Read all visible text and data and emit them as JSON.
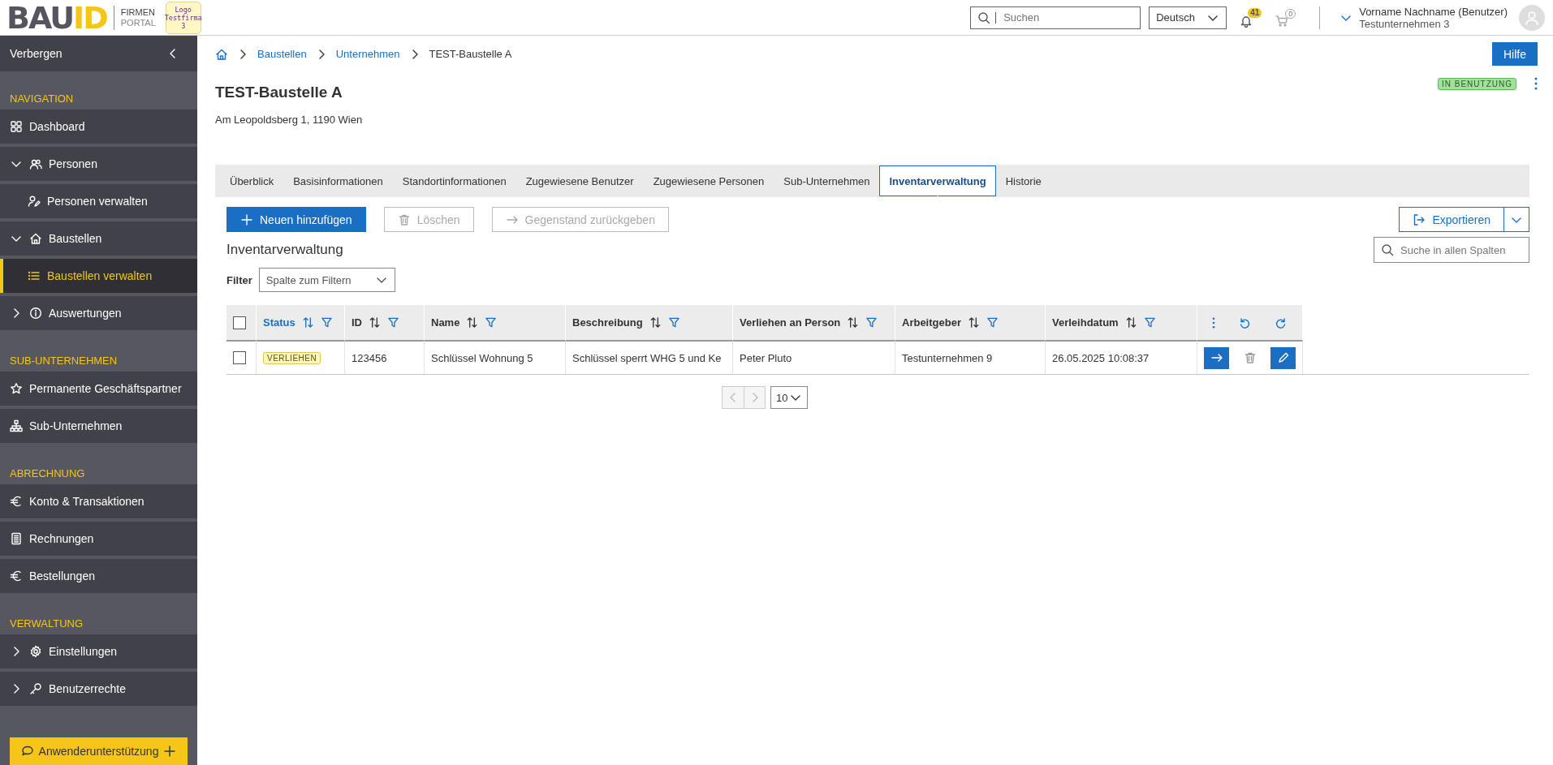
{
  "header": {
    "logo": {
      "dark": "BAU",
      "accent": "ID",
      "line_1": "FIRMEN",
      "line_2": "PORTAL"
    },
    "company_logo": [
      "Logo",
      "Testfirma",
      "3"
    ],
    "search": {
      "placeholder": "Suchen"
    },
    "language": "Deutsch",
    "notifications": "41",
    "cart": "0",
    "user": {
      "name": "Vorname Nachname (Benutzer)",
      "company": "Testunternehmen 3"
    }
  },
  "sidebar": {
    "hide_label": "Verbergen",
    "sections": [
      {
        "heading": "NAVIGATION",
        "items": [
          {
            "label": "Dashboard",
            "selected": false
          },
          {
            "label": "Personen",
            "selected": false,
            "expanded": true,
            "children": [
              {
                "label": "Personen verwalten",
                "selected": false
              }
            ]
          },
          {
            "label": "Baustellen",
            "selected": false,
            "expanded": true,
            "children": [
              {
                "label": "Baustellen verwalten",
                "selected": true
              }
            ]
          },
          {
            "label": "Auswertungen",
            "selected": false,
            "expanded": false
          }
        ]
      },
      {
        "heading": "SUB-UNTERNEHMEN",
        "items": [
          {
            "label": "Permanente Geschäftspartner",
            "selected": false
          },
          {
            "label": "Sub-Unternehmen",
            "selected": false
          }
        ]
      },
      {
        "heading": "ABRECHNUNG",
        "items": [
          {
            "label": "Konto & Transaktionen",
            "selected": false
          },
          {
            "label": "Rechnungen",
            "selected": false
          },
          {
            "label": "Bestellungen",
            "selected": false
          }
        ]
      },
      {
        "heading": "VERWALTUNG",
        "items": [
          {
            "label": "Einstellungen",
            "selected": false,
            "expanded": false
          },
          {
            "label": "Benutzerrechte",
            "selected": false,
            "expanded": false
          }
        ]
      }
    ],
    "support_button": "Anwenderunterstützung"
  },
  "breadcrumbs": [
    {
      "label": "Baustellen",
      "link": true
    },
    {
      "label": "Unternehmen",
      "link": true
    },
    {
      "label": "TEST-Baustelle A",
      "link": false
    }
  ],
  "help_button": "Hilfe",
  "page": {
    "title": "TEST-Baustelle A",
    "address": "Am Leopoldsberg 1, 1190 Wien",
    "status": "IN BENUTZUNG"
  },
  "tabs": [
    {
      "label": "Überblick",
      "selected": false
    },
    {
      "label": "Basisinformationen",
      "selected": false
    },
    {
      "label": "Standortinformationen",
      "selected": false
    },
    {
      "label": "Zugewiesene Benutzer",
      "selected": false
    },
    {
      "label": "Zugewiesene Personen",
      "selected": false
    },
    {
      "label": "Sub-Unternehmen",
      "selected": false
    },
    {
      "label": "Inventarverwaltung",
      "selected": true
    },
    {
      "label": "Historie",
      "selected": false
    }
  ],
  "toolbar": [
    {
      "kind": "add",
      "label": "Neuen hinzufügen",
      "disabled": false
    },
    {
      "kind": "delete",
      "label": "Löschen",
      "disabled": true
    },
    {
      "kind": "return",
      "label": "Gegenstand zurückgeben",
      "disabled": true
    }
  ],
  "export_button": "Exportieren",
  "table_title": "Inventarverwaltung",
  "table_search": {
    "placeholder": "Suche in allen Spalten"
  },
  "filter": {
    "label": "Filter",
    "placeholder": "Spalte zum Filtern"
  },
  "table": {
    "header_checked": false,
    "columns": [
      {
        "label": "Status",
        "sorted": true
      },
      {
        "label": "ID",
        "sorted": false
      },
      {
        "label": "Name",
        "sorted": false
      },
      {
        "label": "Beschreibung",
        "sorted": false
      },
      {
        "label": "Verliehen an Person",
        "sorted": false
      },
      {
        "label": "Arbeitgeber",
        "sorted": false
      },
      {
        "label": "Verleihdatum",
        "sorted": false
      }
    ],
    "rows": [
      {
        "checked": false,
        "cells": [
          "VERLIEHEN",
          "123456",
          "Schlüssel Wohnung 5",
          "Schlüssel sperrt WHG 5 und Ke",
          "Peter Pluto",
          "Testunternehmen 9",
          "26.05.2025 10:08:37"
        ],
        "delete_disabled": true
      }
    ]
  },
  "pagination": {
    "previous_disabled": true,
    "next_disabled": true,
    "page_size": "10"
  }
}
